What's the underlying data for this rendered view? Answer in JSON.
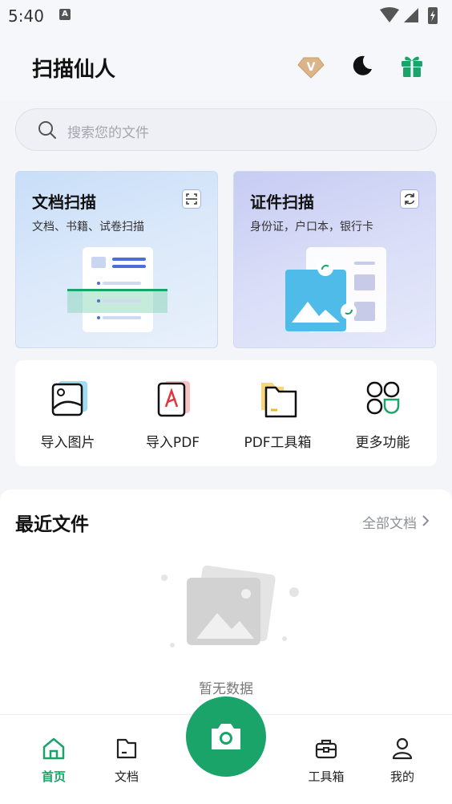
{
  "status_bar": {
    "time": "5:40",
    "notification_letter": "A"
  },
  "header": {
    "title": "扫描仙人",
    "vip_letter": "V",
    "colors": {
      "accent": "#1aa46a",
      "vip": "#d9a873"
    }
  },
  "search": {
    "placeholder": "搜索您的文件"
  },
  "cards": [
    {
      "title": "文档扫描",
      "subtitle": "文档、书籍、试卷扫描"
    },
    {
      "title": "证件扫描",
      "subtitle": "身份证，户口本，银行卡"
    }
  ],
  "tools": [
    {
      "label": "导入图片",
      "icon": "image-import-icon"
    },
    {
      "label": "导入PDF",
      "icon": "pdf-import-icon"
    },
    {
      "label": "PDF工具箱",
      "icon": "pdf-folder-icon"
    },
    {
      "label": "更多功能",
      "icon": "more-apps-icon"
    }
  ],
  "recent": {
    "title": "最近文件",
    "all_label": "全部文档",
    "empty_text": "暂无数据"
  },
  "bottom_nav": [
    {
      "label": "首页",
      "icon": "home-icon",
      "active": true
    },
    {
      "label": "文档",
      "icon": "folder-icon",
      "active": false
    },
    {
      "label": "工具箱",
      "icon": "toolbox-icon",
      "active": false
    },
    {
      "label": "我的",
      "icon": "user-icon",
      "active": false
    }
  ]
}
